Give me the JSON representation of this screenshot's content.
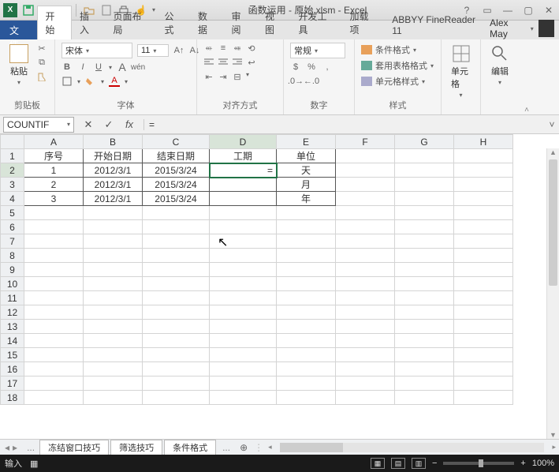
{
  "titlebar": {
    "title": "函数运用 - 原始.xlsm - Excel",
    "qat_icons": [
      "save-icon",
      "undo-icon",
      "redo-icon",
      "open-icon",
      "new-icon",
      "print-icon"
    ]
  },
  "ribbon": {
    "file": "文件",
    "tabs": [
      "开始",
      "插入",
      "页面布局",
      "公式",
      "数据",
      "审阅",
      "视图",
      "开发工具",
      "加载项",
      "ABBYY FineReader 11"
    ],
    "active_tab": 0,
    "user": "Alex May",
    "groups": {
      "clipboard": {
        "label": "剪贴板",
        "paste": "粘贴"
      },
      "font": {
        "label": "字体",
        "family": "宋体",
        "size": "11",
        "buttons": [
          "B",
          "I",
          "U"
        ]
      },
      "alignment": {
        "label": "对齐方式"
      },
      "number": {
        "label": "数字",
        "format": "常规"
      },
      "styles": {
        "label": "样式",
        "cond": "条件格式",
        "tablefmt": "套用表格格式",
        "cellstyle": "单元格样式"
      },
      "cells": {
        "label": "单元格"
      },
      "editing": {
        "label": "编辑"
      }
    }
  },
  "formula_bar": {
    "namebox": "COUNTIF",
    "formula": "="
  },
  "columns": [
    "A",
    "B",
    "C",
    "D",
    "E",
    "F",
    "G",
    "H"
  ],
  "rows": [
    1,
    2,
    3,
    4,
    5,
    6,
    7,
    8,
    9,
    10,
    11,
    12,
    13,
    14,
    15,
    16,
    17,
    18
  ],
  "active_cell": "D2",
  "data": {
    "1": {
      "A": "序号",
      "B": "开始日期",
      "C": "结束日期",
      "D": "工期",
      "E": "单位"
    },
    "2": {
      "A": "1",
      "B": "2012/3/1",
      "C": "2015/3/24",
      "D": "=",
      "E": "天"
    },
    "3": {
      "A": "2",
      "B": "2012/3/1",
      "C": "2015/3/24",
      "D": "",
      "E": "月"
    },
    "4": {
      "A": "3",
      "B": "2012/3/1",
      "C": "2015/3/24",
      "D": "",
      "E": "年"
    }
  },
  "sheets": {
    "tabs": [
      "冻结窗口技巧",
      "筛选技巧",
      "条件格式"
    ],
    "dots": "..."
  },
  "statusbar": {
    "mode": "输入",
    "zoom": "100%"
  },
  "colors": {
    "accent": "#217346",
    "fileblue": "#2a579a"
  }
}
